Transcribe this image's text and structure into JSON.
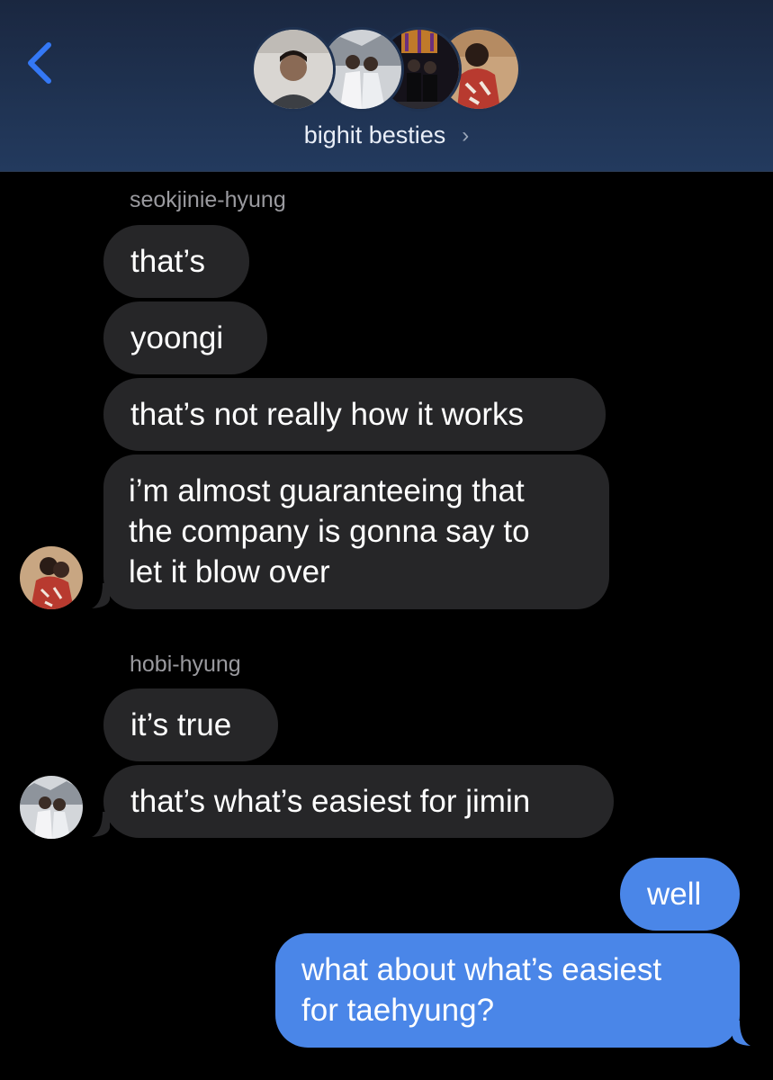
{
  "header": {
    "group_name": "bighit besties",
    "chevron": "›",
    "back_icon": "chevron-left-icon",
    "accent_color": "#3478f6"
  },
  "thread": {
    "senders": [
      {
        "name": "seokjinie-hyung"
      },
      {
        "name": "hobi-hyung"
      }
    ],
    "messages": [
      {
        "text": "that’s"
      },
      {
        "text": "yoongi"
      },
      {
        "text": "that’s not really how it works"
      },
      {
        "line1": "i’m almost guaranteeing that",
        "line2": "the company is gonna say to",
        "line3": "let it blow over"
      },
      {
        "text": "it’s true"
      },
      {
        "text": "that’s what’s easiest for jimin"
      },
      {
        "text": "well"
      },
      {
        "line1": "what about what’s easiest",
        "line2": "for taehyung?"
      }
    ]
  },
  "colors": {
    "incoming_bubble": "#262628",
    "outgoing_bubble": "#4a86e8",
    "background": "#000000",
    "sender_label": "#9a9a9f"
  }
}
